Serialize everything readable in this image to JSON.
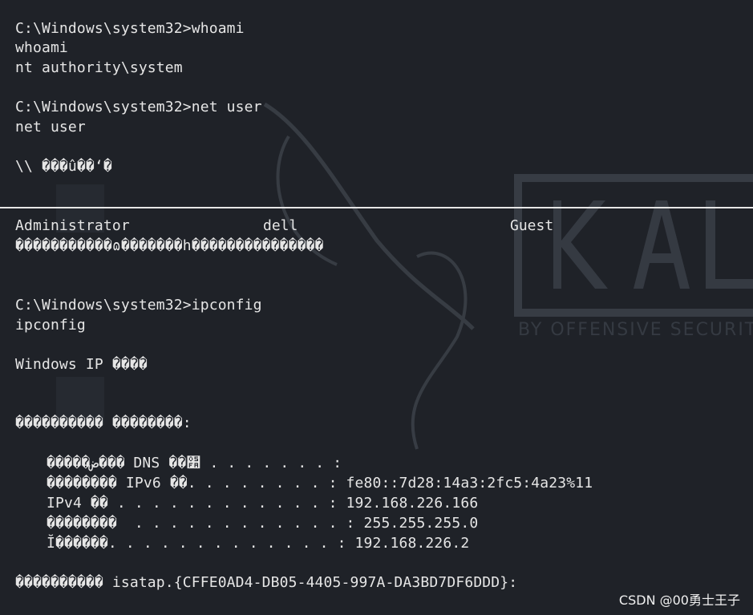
{
  "terminal": {
    "lines": {
      "l1": "C:\\Windows\\system32>whoami",
      "l2": "whoami",
      "l3": "nt authority\\system",
      "l4": "C:\\Windows\\system32>net user",
      "l5": "net user",
      "l6": "\\\\ ���û��ʻ�",
      "l8": "Administrator",
      "l8b": "dell",
      "l8c": "Guest",
      "l9": "�����������ɷ�������h���������������",
      "l10": "C:\\Windows\\system32>ipconfig",
      "l11": "ipconfig",
      "l12": "Windows IP ����",
      "l13": "���������� ��������:",
      "l14": "�����ض��� DNS ��׺ . . . . . . . :",
      "l15": "�������� IPv6 ��. . . . . . . . : fe80::7d28:14a3:2fc5:4a23%11",
      "l16": "IPv4 �� . . . . . . . . . . . . : 192.168.226.166",
      "l17": "��������  . . . . . . . . . . . . : 255.255.255.0",
      "l18": "Ĭ������. . . . . . . . . . . . . : 192.168.226.2",
      "l19": "���������� isatap.{CFFE0AD4-DB05-4405-997A-DA3BD7DF6DDD}:"
    }
  },
  "watermark": {
    "text": "CSDN @00勇士王子"
  },
  "colors": {
    "background": "#1f2228",
    "text": "#e6e6e6"
  }
}
